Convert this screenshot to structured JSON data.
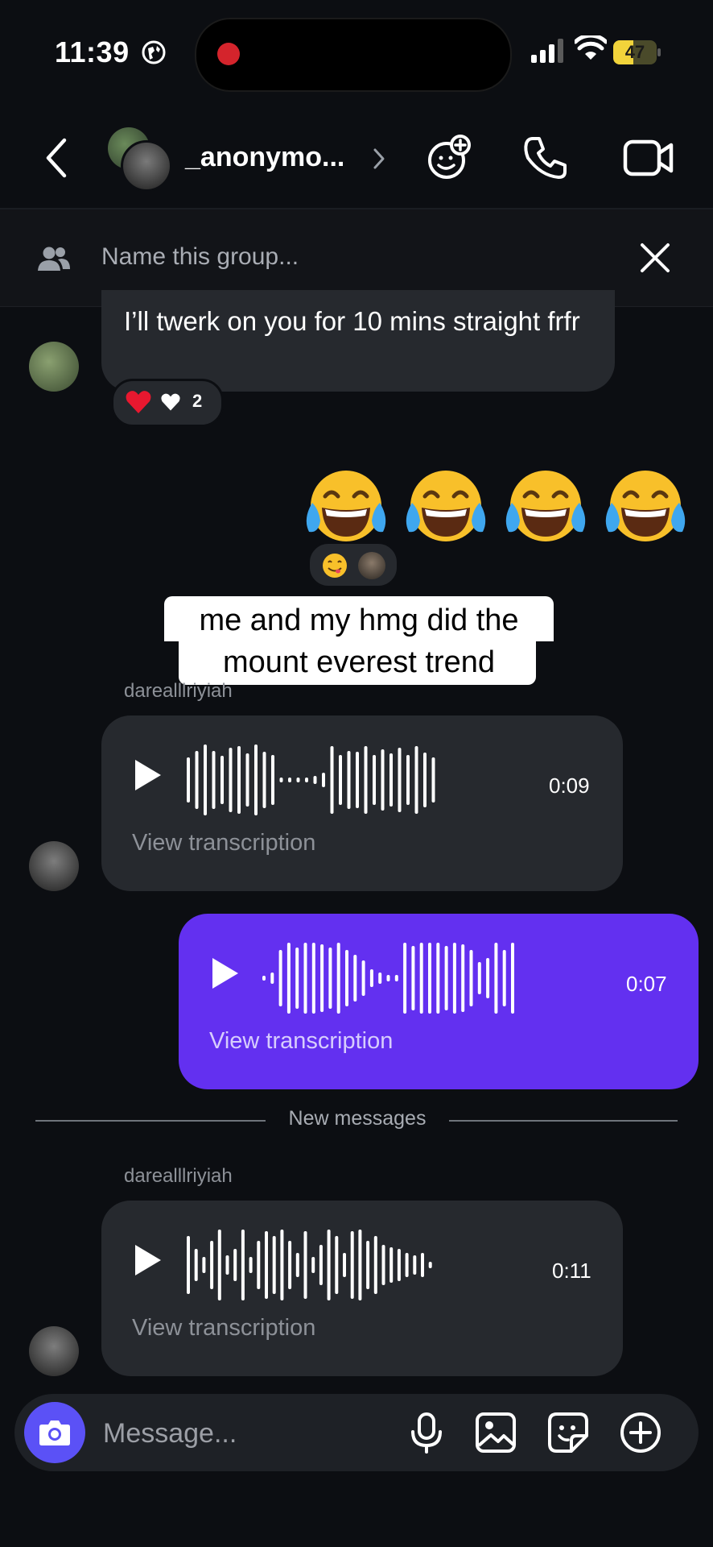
{
  "status_bar": {
    "time": "11:39",
    "battery": "47",
    "battery_level": 0.47
  },
  "header": {
    "title": "_anonymo..."
  },
  "group_bar": {
    "placeholder": "Name this group..."
  },
  "messages": {
    "msg1": {
      "text": "I’ll twerk on you for 10 mins straight frfr",
      "reaction_count": "2"
    },
    "caption": "me and my hmg did the mount  everest trend",
    "voice1": {
      "sender": "darealllriyiah",
      "duration": "0:09",
      "transcription_label": "View transcription"
    },
    "voice2": {
      "duration": "0:07",
      "transcription_label": "View transcription"
    },
    "new_messages_label": "New messages",
    "voice3": {
      "sender": "darealllriyiah",
      "duration": "0:11",
      "transcription_label": "View transcription"
    }
  },
  "composer": {
    "placeholder": "Message..."
  },
  "colors": {
    "background": "#0c0e12",
    "incoming_bubble": "#26292e",
    "outgoing_bubble": "#6330f0",
    "camera_button": "#5b51f6"
  }
}
